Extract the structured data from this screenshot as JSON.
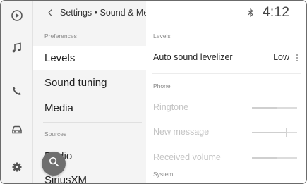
{
  "header": {
    "title": "Settings • Sound & Media"
  },
  "rail": {
    "icons": [
      "play-icon",
      "music-icon",
      "phone-icon",
      "car-icon",
      "settings-icon"
    ]
  },
  "sidebar": {
    "preferences_label": "Preferences",
    "sources_label": "Sources",
    "items": [
      {
        "label": "Levels",
        "selected": true
      },
      {
        "label": "Sound tuning"
      },
      {
        "label": "Media"
      }
    ],
    "source_items": [
      {
        "label": "Radio"
      },
      {
        "label": "SiriusXM"
      }
    ]
  },
  "status": {
    "time": "4:12",
    "bluetooth": "bluetooth-icon"
  },
  "panel": {
    "levels_label": "Levels",
    "auto_sound_leveler": {
      "label": "Auto sound levelizer",
      "value": "Low"
    },
    "phone_label": "Phone",
    "phone_rows": [
      {
        "label": "Ringtone",
        "level": 0.55
      },
      {
        "label": "New message",
        "level": 0.75
      },
      {
        "label": "Received volume",
        "level": 0.55
      }
    ],
    "system_label": "System"
  },
  "colors": {
    "accent": "#6e6e6e",
    "rail_bg": "#f4f4f4",
    "disabled_text": "#c4c4c4"
  }
}
